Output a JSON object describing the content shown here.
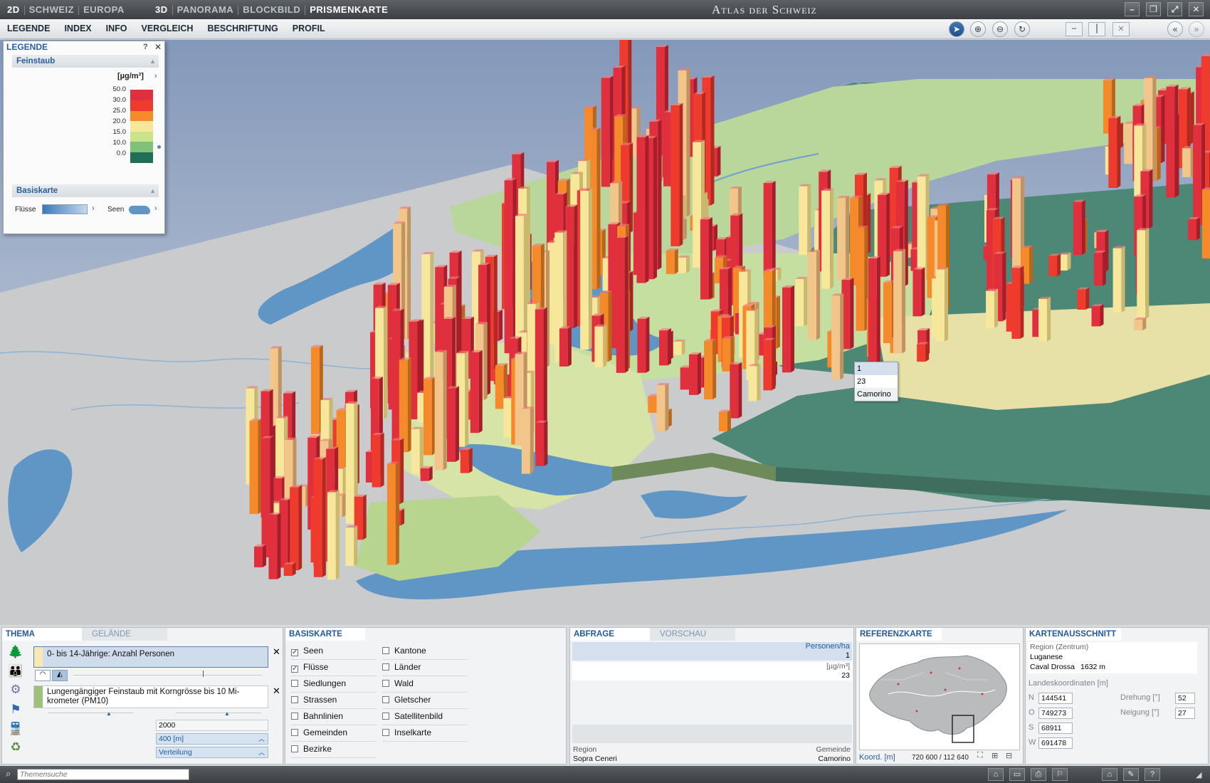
{
  "titlebar": {
    "tabs_2d": [
      "2D",
      "SCHWEIZ",
      "EUROPA"
    ],
    "tabs_3d": [
      "3D",
      "PANORAMA",
      "BLOCKBILD",
      "PRISMENKARTE"
    ],
    "app_title": "Atlas der Schweiz"
  },
  "menubar": {
    "items": [
      "LEGENDE",
      "INDEX",
      "INFO",
      "VERGLEICH",
      "BESCHRIFTUNG",
      "PROFIL"
    ]
  },
  "legend": {
    "title": "LEGENDE",
    "section_feinstaub": "Feinstaub",
    "unit": "[µg/m³]",
    "ticks": [
      "50.0",
      "30.0",
      "25.0",
      "20.0",
      "15.0",
      "10.0",
      "0.0"
    ],
    "colors": [
      "#e0303e",
      "#ee3b2e",
      "#f58a2a",
      "#f7e79a",
      "#cbe38a",
      "#7fc17a",
      "#1f6e5a"
    ],
    "section_basiskarte": "Basiskarte",
    "fluesse_label": "Flüsse",
    "seen_label": "Seen"
  },
  "tooltip": {
    "values": [
      "1",
      "23",
      "Camorino"
    ]
  },
  "thema": {
    "tab_active": "THEMA",
    "tab_inactive": "GELÄNDE",
    "layer1": "0- bis 14-Jährige: Anzahl Personen",
    "layer2": "Lungengängiger Feinstaub mit Korngrösse bis 10 Mi-krometer (PM10)",
    "year": "2000",
    "resolution": "400 [m]",
    "classification": "Verteilung"
  },
  "basiskarte": {
    "title": "BASISKARTE",
    "col1": [
      {
        "label": "Seen",
        "checked": true
      },
      {
        "label": "Flüsse",
        "checked": true
      },
      {
        "label": "Siedlungen",
        "checked": false
      },
      {
        "label": "Strassen",
        "checked": false
      },
      {
        "label": "Bahnlinien",
        "checked": false
      },
      {
        "label": "Gemeinden",
        "checked": false
      },
      {
        "label": "Bezirke",
        "checked": false
      }
    ],
    "col2": [
      {
        "label": "Kantone",
        "checked": false
      },
      {
        "label": "Länder",
        "checked": false
      },
      {
        "label": "Wald",
        "checked": false
      },
      {
        "label": "Gletscher",
        "checked": false
      },
      {
        "label": "Satellitenbild",
        "checked": false
      },
      {
        "label": "Inselkarte",
        "checked": false
      }
    ]
  },
  "abfrage": {
    "tab_active": "ABFRAGE",
    "tab_inactive": "VORSCHAU",
    "unit1": "Personen/ha",
    "value1": "1",
    "unit2": "[µg/m³]",
    "value2": "23",
    "region_label": "Region",
    "region_value": "Sopra Ceneri",
    "gemeinde_label": "Gemeinde",
    "gemeinde_value": "Camorino"
  },
  "referenzkarte": {
    "title": "REFERENZKARTE",
    "koord_label": "Koord. [m]",
    "koord_value": "720 600 / 112 640"
  },
  "kartenausschnitt": {
    "title": "KARTENAUSSCHNITT",
    "region_label": "Region (Zentrum)",
    "region_value": "Luganese",
    "place": "Caval Drossa",
    "altitude": "1632 m",
    "koord_label": "Landeskoordinaten [m]",
    "n_label": "N",
    "n_value": "144541",
    "o_label": "O",
    "o_value": "749273",
    "s_label": "S",
    "s_value": "68911",
    "w_label": "W",
    "w_value": "691478",
    "drehung_label": "Drehung [°]",
    "drehung_value": "52",
    "neigung_label": "Neigung [°]",
    "neigung_value": "27"
  },
  "search": {
    "placeholder": "Themensuche"
  }
}
